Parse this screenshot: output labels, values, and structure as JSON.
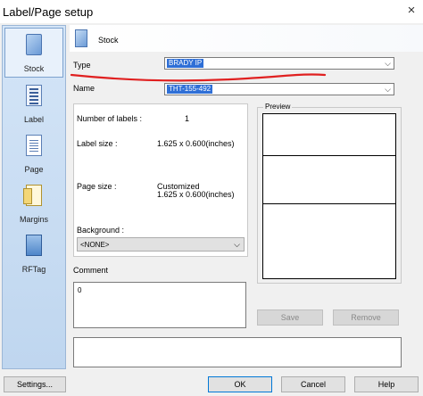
{
  "window": {
    "title": "Label/Page setup",
    "close": "×"
  },
  "nav": {
    "items": [
      {
        "label": "Stock",
        "icon": "stock-icon"
      },
      {
        "label": "Label",
        "icon": "label-icon"
      },
      {
        "label": "Page",
        "icon": "page-icon"
      },
      {
        "label": "Margins",
        "icon": "margins-icon"
      },
      {
        "label": "RFTag",
        "icon": "rftag-icon"
      }
    ]
  },
  "header": {
    "title": "Stock"
  },
  "form": {
    "type_label": "Type",
    "type_value": "BRADY IP",
    "name_label": "Name",
    "name_value": "THT-155-492"
  },
  "info": {
    "num_labels_label": "Number of labels :",
    "num_labels_value": "1",
    "label_size_label": "Label size :",
    "label_size_value": "1.625 x 0.600(inches)",
    "page_size_label": "Page size :",
    "page_size_value_line1": "Customized",
    "page_size_value_line2": "1.625 x 0.600(inches)",
    "background_label": "Background :",
    "background_value": "<NONE>"
  },
  "preview": {
    "label": "Preview"
  },
  "comment": {
    "label": "Comment",
    "value": "0"
  },
  "buttons": {
    "save": "Save",
    "remove": "Remove",
    "settings": "Settings...",
    "ok": "OK",
    "cancel": "Cancel",
    "help": "Help"
  },
  "colors": {
    "accent": "#2f6fd6",
    "annotation": "#e02020"
  }
}
